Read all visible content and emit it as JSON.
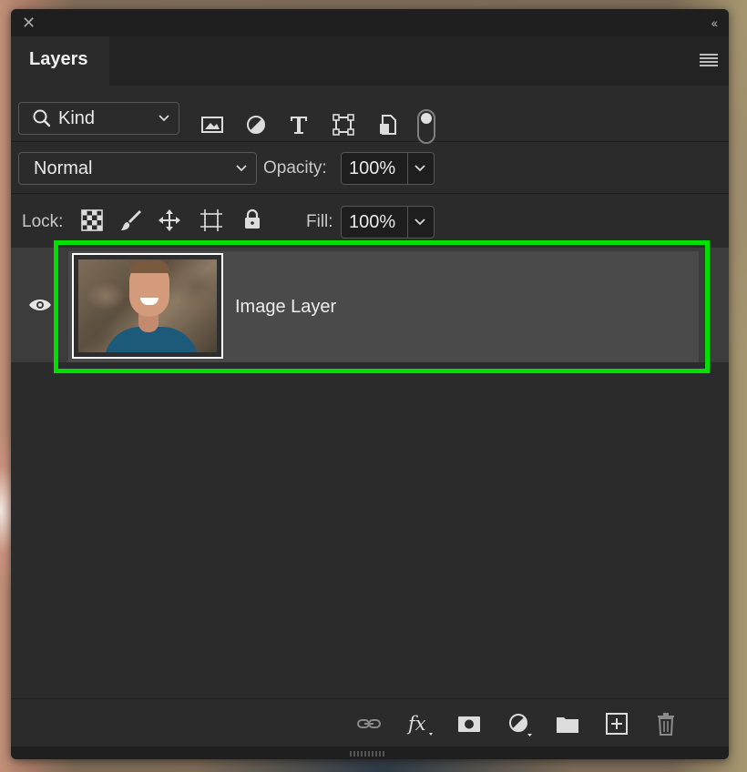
{
  "panel": {
    "title_tab": "Layers",
    "close_glyph": "✕",
    "collapse_glyph": "‹‹"
  },
  "filter": {
    "kind_label": "Kind",
    "icons": [
      "image-filter-icon",
      "adjustment-filter-icon",
      "type-filter-icon",
      "shape-filter-icon",
      "smart-object-filter-icon"
    ],
    "toggle_on": true
  },
  "blend": {
    "mode": "Normal",
    "opacity_label": "Opacity:",
    "opacity_value": "100%"
  },
  "lock": {
    "label": "Lock:",
    "icons": [
      "lock-transparent-pixels-icon",
      "lock-image-pixels-icon",
      "lock-position-icon",
      "lock-artboard-icon",
      "lock-all-icon"
    ],
    "fill_label": "Fill:",
    "fill_value": "100%"
  },
  "layers": [
    {
      "name": "Image Layer",
      "visible": true,
      "selected": true
    }
  ],
  "footer_tools": [
    "link-layers-icon",
    "fx-icon",
    "layer-mask-icon",
    "adjustment-layer-icon",
    "group-folder-icon",
    "new-layer-icon",
    "delete-layer-icon"
  ],
  "colors": {
    "panel_bg": "#2b2b2b",
    "selected_layer_bg": "#4a4a4a",
    "highlight": "#00e000"
  }
}
